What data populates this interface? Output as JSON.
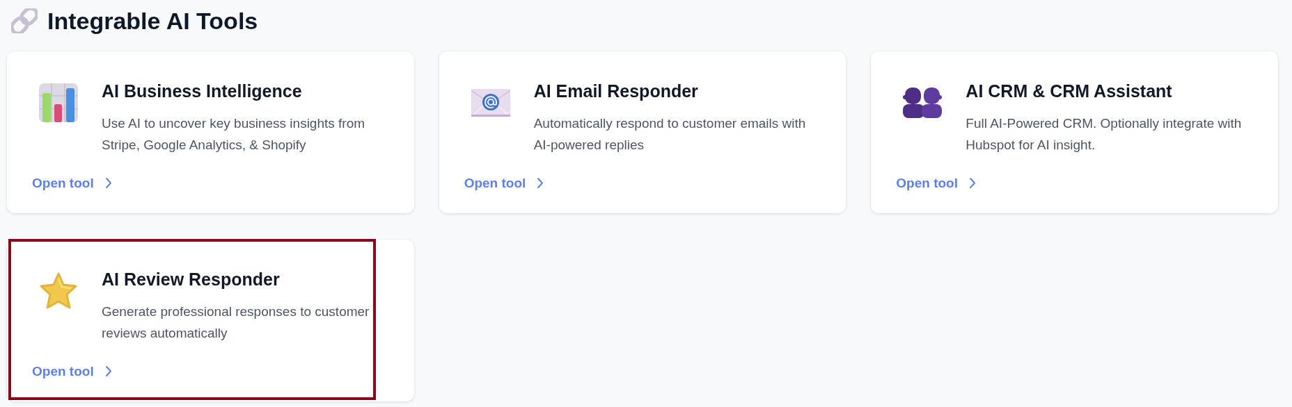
{
  "heading": {
    "title": "Integrable AI Tools"
  },
  "tools": [
    {
      "title": "AI Business Intelligence",
      "description": "Use AI to uncover key business insights from Stripe, Google Analytics, & Shopify",
      "link": "Open tool",
      "highlighted": false
    },
    {
      "title": "AI Email Responder",
      "description": "Automatically respond to customer emails with AI-powered replies",
      "link": "Open tool",
      "highlighted": false
    },
    {
      "title": "AI CRM & CRM Assistant",
      "description": "Full AI-Powered CRM. Optionally integrate with Hubspot for AI insight.",
      "link": "Open tool",
      "highlighted": false
    },
    {
      "title": "AI Review Responder",
      "description": "Generate professional responses to customer reviews automatically",
      "link": "Open tool",
      "highlighted": true
    }
  ]
}
